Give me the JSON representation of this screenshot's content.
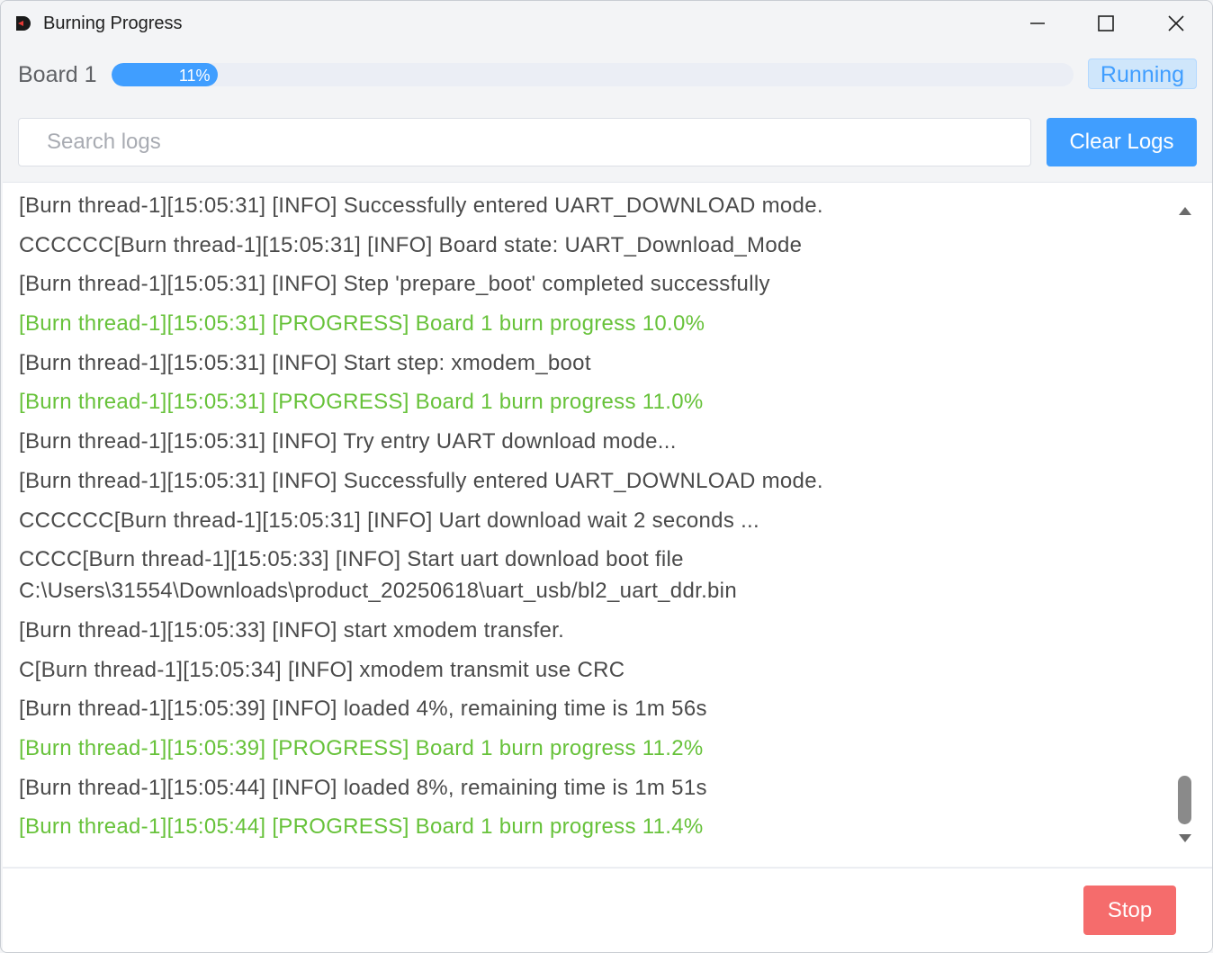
{
  "window": {
    "title": "Burning Progress",
    "icons": {
      "app": "app-logo-icon",
      "minimize": "minimize-icon",
      "maximize": "maximize-icon",
      "close": "close-icon"
    }
  },
  "board": {
    "label": "Board 1",
    "progress_percent": 11,
    "progress_text": "11%",
    "status": "Running"
  },
  "search": {
    "placeholder": "Search logs",
    "value": ""
  },
  "toolbar": {
    "clear_label": "Clear Logs"
  },
  "logs": [
    {
      "text": "[Burn thread-1][15:05:31] [INFO] Successfully entered UART_DOWNLOAD mode.",
      "level": "info"
    },
    {
      "text": "CCCCCC[Burn thread-1][15:05:31] [INFO] Board state: UART_Download_Mode",
      "level": "info"
    },
    {
      "text": "[Burn thread-1][15:05:31] [INFO] Step 'prepare_boot' completed successfully",
      "level": "info"
    },
    {
      "text": "[Burn thread-1][15:05:31] [PROGRESS] Board 1 burn progress 10.0%",
      "level": "progress"
    },
    {
      "text": "[Burn thread-1][15:05:31] [INFO] Start step: xmodem_boot",
      "level": "info"
    },
    {
      "text": "[Burn thread-1][15:05:31] [PROGRESS] Board 1 burn progress 11.0%",
      "level": "progress"
    },
    {
      "text": "[Burn thread-1][15:05:31] [INFO] Try entry UART download mode...",
      "level": "info"
    },
    {
      "text": "[Burn thread-1][15:05:31] [INFO] Successfully entered UART_DOWNLOAD mode.",
      "level": "info"
    },
    {
      "text": "CCCCCC[Burn thread-1][15:05:31] [INFO] Uart download wait 2 seconds ...",
      "level": "info"
    },
    {
      "text": "CCCC[Burn thread-1][15:05:33] [INFO] Start uart download boot file C:\\Users\\31554\\Downloads\\product_20250618\\uart_usb/bl2_uart_ddr.bin",
      "level": "info"
    },
    {
      "text": "[Burn thread-1][15:05:33] [INFO] start xmodem transfer.",
      "level": "info"
    },
    {
      "text": "C[Burn thread-1][15:05:34] [INFO] xmodem transmit use CRC",
      "level": "info"
    },
    {
      "text": "[Burn thread-1][15:05:39] [INFO] loaded 4%, remaining time is 1m 56s",
      "level": "info"
    },
    {
      "text": "[Burn thread-1][15:05:39] [PROGRESS] Board 1 burn progress 11.2%",
      "level": "progress"
    },
    {
      "text": "[Burn thread-1][15:05:44] [INFO] loaded 8%, remaining time is 1m 51s",
      "level": "info"
    },
    {
      "text": "[Burn thread-1][15:05:44] [PROGRESS] Board 1 burn progress 11.4%",
      "level": "progress"
    }
  ],
  "colors": {
    "accent": "#409eff",
    "progress_log": "#67c23a",
    "stop": "#f56c6c"
  },
  "footer": {
    "stop_label": "Stop"
  }
}
